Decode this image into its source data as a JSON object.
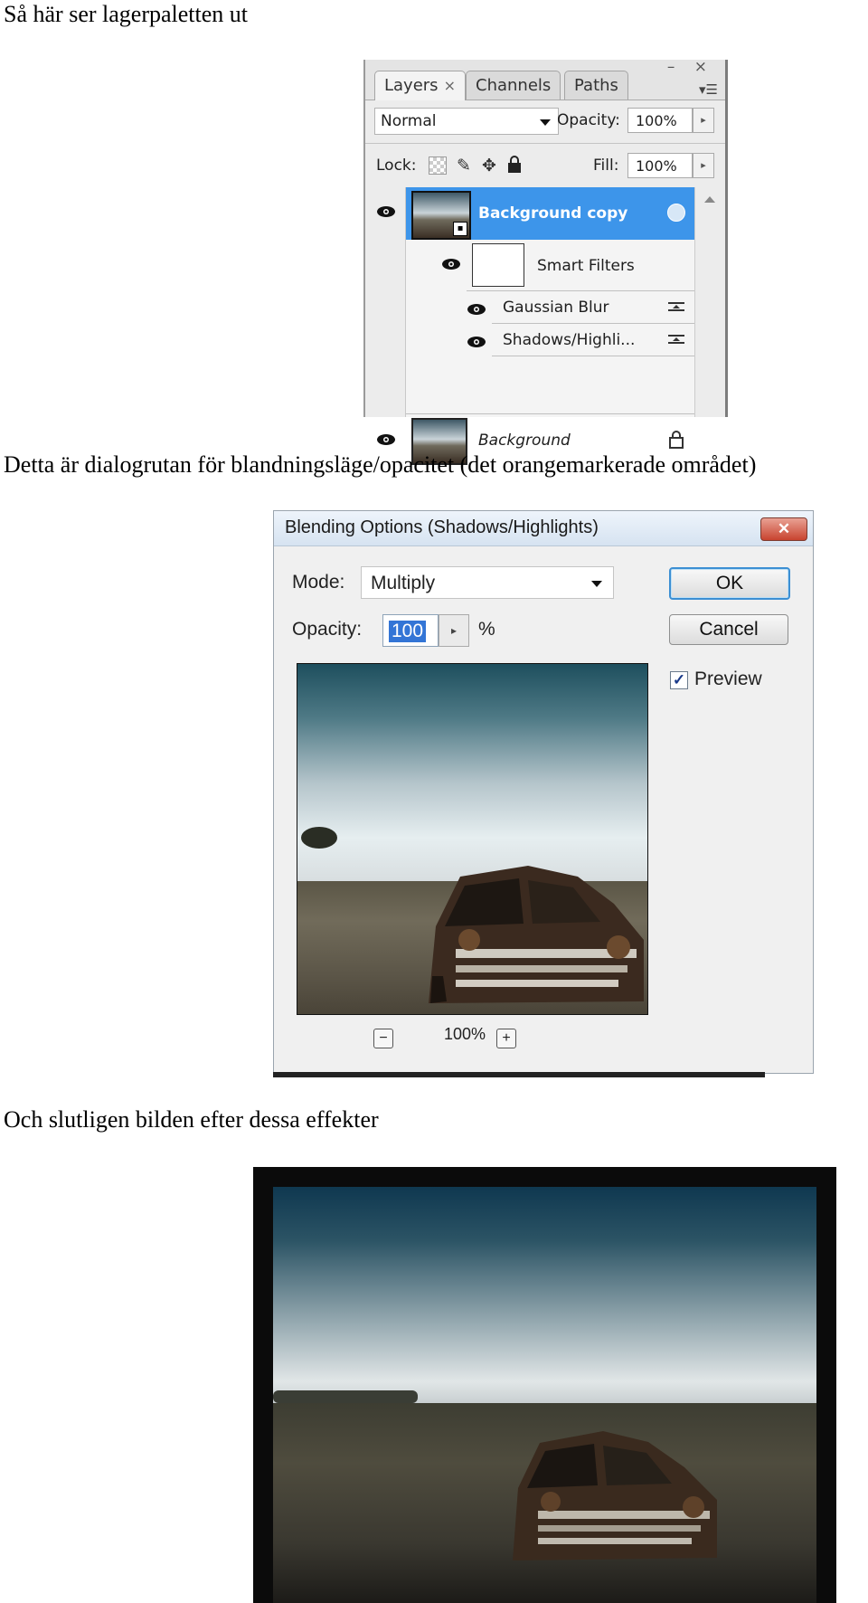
{
  "captions": {
    "layers_intro": "Så här ser lagerpaletten ut",
    "dialog_intro": "Detta är dialogrutan för blandningsläge/opacitet (det orangemarkerade området)",
    "final_intro": "Och slutligen bilden efter dessa effekter"
  },
  "layers_panel": {
    "tabs": [
      {
        "label": "Layers",
        "active": true
      },
      {
        "label": "Channels",
        "active": false
      },
      {
        "label": "Paths",
        "active": false
      }
    ],
    "tab_close_glyph": "×",
    "window_controls": "– ×",
    "menu_glyph": "▾☰",
    "blend_mode": "Normal",
    "opacity_label": "Opacity:",
    "opacity_value": "100%",
    "lock_label": "Lock:",
    "fill_label": "Fill:",
    "fill_value": "100%",
    "arrow_glyph": "▸",
    "layers": {
      "background_copy": "Background copy",
      "smart_filters": "Smart Filters",
      "gaussian_blur": "Gaussian Blur",
      "shadows_highlights": "Shadows/Highli...",
      "background": "Background"
    },
    "selection_color": "#3d95ea"
  },
  "blending_dialog": {
    "title": "Blending Options (Shadows/Highlights)",
    "close_glyph": "✕",
    "mode_label": "Mode:",
    "mode_value": "Multiply",
    "opacity_label": "Opacity:",
    "opacity_value": "100",
    "percent_sign": "%",
    "ok_label": "OK",
    "cancel_label": "Cancel",
    "preview_label": "Preview",
    "preview_checked": true,
    "check_glyph": "✓",
    "zoom_out_glyph": "−",
    "zoom_in_glyph": "+",
    "zoom_value": "100%"
  }
}
